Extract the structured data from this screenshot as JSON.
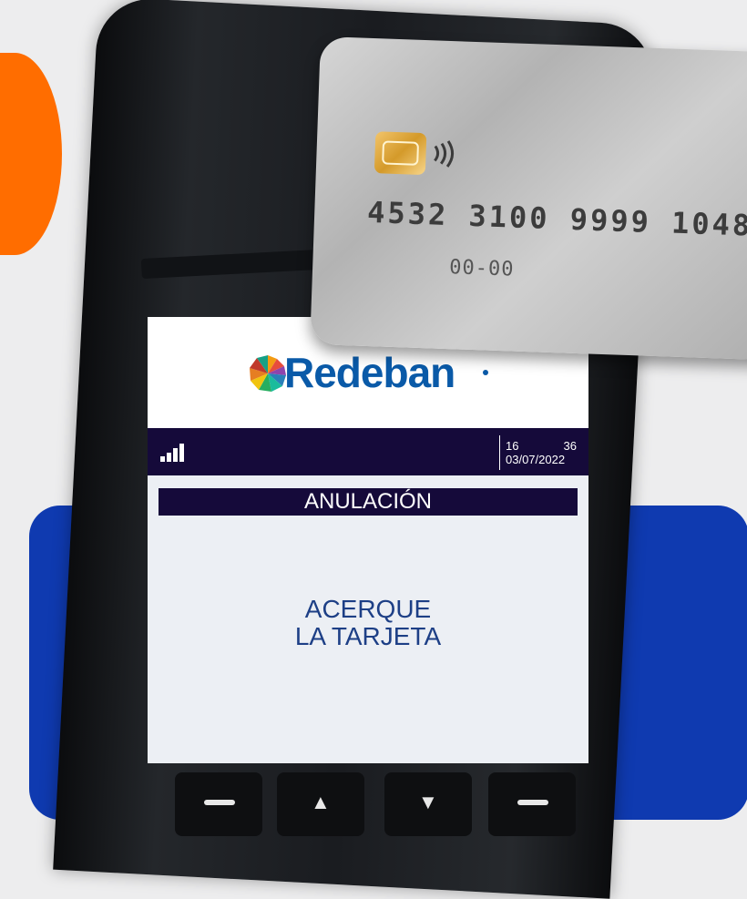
{
  "brand": {
    "name": "Redeban",
    "colors": {
      "primary": "#0a5aa8",
      "accent_orange": "#ff6d00",
      "accent_blue": "#0f3ab0",
      "header_bg": "#150a3a"
    }
  },
  "status_bar": {
    "signal_icon": "signal-strength-icon",
    "time_hour": "16",
    "time_minute": "36",
    "date": "03/07/2022"
  },
  "screen": {
    "title": "ANULACIÓN",
    "message_line1": "ACERQUE",
    "message_line2": "LA TARJETA"
  },
  "card": {
    "number": "4532 3100 9999 1048",
    "expiry": "00-00",
    "chip_icon": "chip-icon",
    "contactless_icon": "contactless-icon"
  },
  "keypad": {
    "keys": [
      "minus-key-icon",
      "up-arrow-icon",
      "down-arrow-icon",
      "minus-key-icon"
    ]
  }
}
